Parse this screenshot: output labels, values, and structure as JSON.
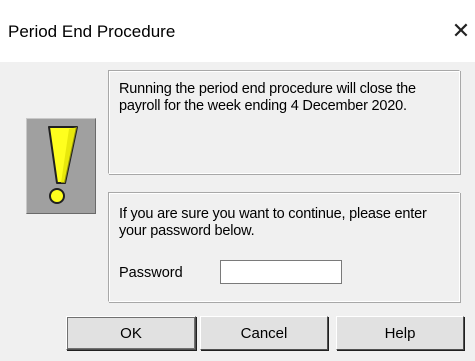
{
  "window": {
    "title": "Period End Procedure",
    "close_glyph": "✕"
  },
  "warning": {
    "icon": "exclamation-icon",
    "colors": {
      "fill": "#ffff1e",
      "outline": "#202020",
      "background": "#a0a0a0"
    }
  },
  "message": {
    "info": "Running the period end procedure will close the payroll  for the week ending 4 December 2020.",
    "prompt": "If you are sure you want to continue, please enter your password below."
  },
  "password": {
    "label": "Password",
    "value": ""
  },
  "buttons": {
    "ok": "OK",
    "cancel": "Cancel",
    "help": "Help"
  }
}
